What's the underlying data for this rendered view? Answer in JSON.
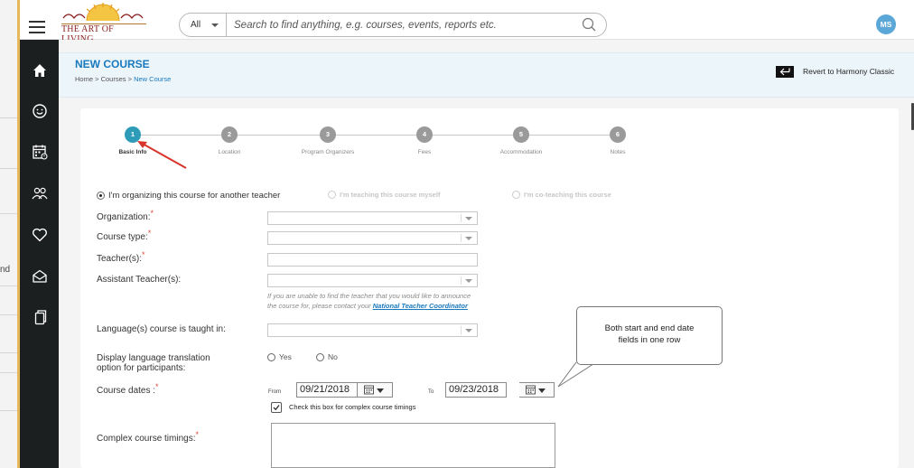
{
  "outer_fragment": "nd",
  "header": {
    "logo_text": "THE ART OF LIVING",
    "search_scope": "All",
    "search_placeholder": "Search to find anything, e.g. courses, events, reports etc.",
    "avatar_initials": "MS"
  },
  "sidebar": {
    "items": [
      "home-icon",
      "smiley-icon",
      "calendar-icon",
      "people-icon",
      "heart-icon",
      "envelope-icon",
      "documents-icon"
    ]
  },
  "page": {
    "title": "NEW COURSE",
    "breadcrumb": {
      "home": "Home",
      "sep1": " > ",
      "courses": "Courses",
      "sep2": " > ",
      "current": "New Course"
    },
    "revert_label": "Revert to Harmony Classic"
  },
  "stepper": {
    "active": 1,
    "steps": [
      {
        "num": "1",
        "label": "Basic Info"
      },
      {
        "num": "2",
        "label": "Location"
      },
      {
        "num": "3",
        "label": "Program Organizers"
      },
      {
        "num": "4",
        "label": "Fees"
      },
      {
        "num": "5",
        "label": "Accommodation"
      },
      {
        "num": "6",
        "label": "Notes"
      }
    ]
  },
  "form": {
    "role_options": [
      {
        "label": "I'm organizing this course for another teacher",
        "selected": true
      },
      {
        "label": "I'm teaching this course myself",
        "selected": false
      },
      {
        "label": "I'm co-teaching this course",
        "selected": false
      }
    ],
    "labels": {
      "organization": "Organization:",
      "course_type": "Course type:",
      "teachers": "Teacher(s):",
      "assistant_teachers": "Assistant Teacher(s):",
      "language": "Language(s) course is taught in:",
      "translation_line1": "Display language translation",
      "translation_line2": "option for participants:",
      "course_dates": "Course dates :",
      "complex_timings": "Complex course timings:"
    },
    "required_mark": "*",
    "helper_line1": "If you are unable to find the teacher that you would like to announce",
    "helper_line2": "the course for, please contact your ",
    "helper_link": "National Teacher Coordinator",
    "translation_yes": "Yes",
    "translation_no": "No",
    "from_label": "From",
    "to_label": "To",
    "start_date": "09/21/2018",
    "end_date": "09/23/2018",
    "complex_checkbox_label": "Check this box for complex course timings",
    "complex_checked": true
  },
  "annotation": {
    "callout_line1": "Both start and end date",
    "callout_line2": "fields in one row"
  }
}
